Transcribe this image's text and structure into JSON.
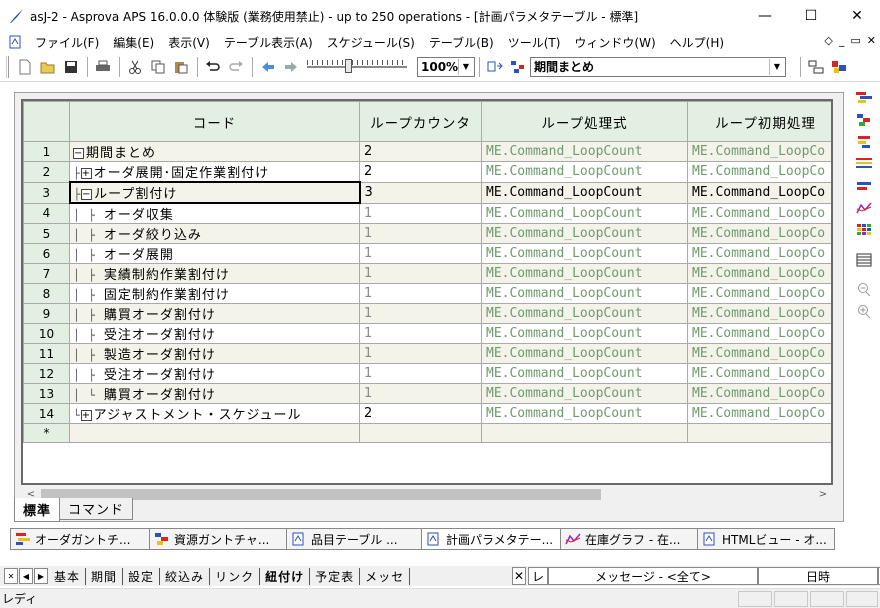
{
  "window": {
    "title": "asJ-2 - Asprova APS 16.0.0.0 体験版 (業務使用禁止)  - up to 250 operations  - [計画パラメタテーブル - 標準]",
    "minimize": "—",
    "maximize": "☐",
    "close": "✕"
  },
  "menu": {
    "items": [
      "ファイル(F)",
      "編集(E)",
      "表示(V)",
      "テーブル表示(A)",
      "スケジュール(S)",
      "テーブル(B)",
      "ツール(T)",
      "ウィンドウ(W)",
      "ヘルプ(H)"
    ],
    "mdi_min": "_",
    "mdi_restore": "▭",
    "mdi_close": "✕"
  },
  "toolbar": {
    "zoom_value": "100%",
    "view_value": "期間まとめ"
  },
  "grid": {
    "headers": [
      "コード",
      "ループカウンタ",
      "ループ処理式",
      "ループ初期処理"
    ],
    "header_visible_partial": "ループ初期処理",
    "rows": [
      {
        "num": "1",
        "lead": "",
        "toggle": "⊟",
        "name": "期間まとめ",
        "count": "2",
        "expr": "ME.Command_LoopCount",
        "init": "ME.Command_LoopCo",
        "count_style": "dark"
      },
      {
        "num": "2",
        "lead": "├",
        "toggle": "⊞",
        "name": "オーダ展開･固定作業割付け",
        "count": "2",
        "expr": "ME.Command_LoopCount",
        "init": "ME.Command_LoopCo",
        "count_style": "dark"
      },
      {
        "num": "3",
        "lead": "├",
        "toggle": "⊟",
        "name": "ループ割付け",
        "count": "3",
        "expr": "ME.Command_LoopCount",
        "init": "ME.Command_LoopCo",
        "count_style": "dark"
      },
      {
        "num": "4",
        "lead": "│ ├",
        "toggle": "",
        "name": "オーダ収集",
        "count": "1",
        "expr": "ME.Command_LoopCount",
        "init": "ME.Command_LoopCo",
        "count_style": "grey"
      },
      {
        "num": "5",
        "lead": "│ ├",
        "toggle": "",
        "name": "オーダ絞り込み",
        "count": "1",
        "expr": "ME.Command_LoopCount",
        "init": "ME.Command_LoopCo",
        "count_style": "grey"
      },
      {
        "num": "6",
        "lead": "│ ├",
        "toggle": "",
        "name": "オーダ展開",
        "count": "1",
        "expr": "ME.Command_LoopCount",
        "init": "ME.Command_LoopCo",
        "count_style": "grey"
      },
      {
        "num": "7",
        "lead": "│ ├",
        "toggle": "",
        "name": "実績制約作業割付け",
        "count": "1",
        "expr": "ME.Command_LoopCount",
        "init": "ME.Command_LoopCo",
        "count_style": "grey"
      },
      {
        "num": "8",
        "lead": "│ ├",
        "toggle": "",
        "name": "固定制約作業割付け",
        "count": "1",
        "expr": "ME.Command_LoopCount",
        "init": "ME.Command_LoopCo",
        "count_style": "grey"
      },
      {
        "num": "9",
        "lead": "│ ├",
        "toggle": "",
        "name": "購買オーダ割付け",
        "count": "1",
        "expr": "ME.Command_LoopCount",
        "init": "ME.Command_LoopCo",
        "count_style": "grey"
      },
      {
        "num": "10",
        "lead": "│ ├",
        "toggle": "",
        "name": "受注オーダ割付け",
        "count": "1",
        "expr": "ME.Command_LoopCount",
        "init": "ME.Command_LoopCo",
        "count_style": "grey"
      },
      {
        "num": "11",
        "lead": "│ ├",
        "toggle": "",
        "name": "製造オーダ割付け",
        "count": "1",
        "expr": "ME.Command_LoopCount",
        "init": "ME.Command_LoopCo",
        "count_style": "grey"
      },
      {
        "num": "12",
        "lead": "│ ├",
        "toggle": "",
        "name": "受注オーダ割付け",
        "count": "1",
        "expr": "ME.Command_LoopCount",
        "init": "ME.Command_LoopCo",
        "count_style": "grey"
      },
      {
        "num": "13",
        "lead": "│ └",
        "toggle": "",
        "name": "購買オーダ割付け",
        "count": "1",
        "expr": "ME.Command_LoopCount",
        "init": "ME.Command_LoopCo",
        "count_style": "grey"
      },
      {
        "num": "14",
        "lead": "└",
        "toggle": "⊞",
        "name": "アジャストメント・スケジュール",
        "count": "2",
        "expr": "ME.Command_LoopCount",
        "init": "ME.Command_LoopCo",
        "count_style": "dark"
      }
    ],
    "new_row_marker": "*",
    "selected_row": 3
  },
  "sheet_tabs": [
    "標準",
    "コマンド"
  ],
  "window_tabs": [
    "オーダガントチ...",
    "資源ガントチャ...",
    "品目テーブル ...",
    "計画パラメタテー...",
    "在庫グラフ - 在...",
    "HTMLビュー - オ..."
  ],
  "bottom_nav": {
    "tabs": [
      "基本",
      "期間",
      "設定",
      "絞込み",
      "リンク",
      "紐付け",
      "予定表",
      "メッセ"
    ],
    "active_tab": "紐付け",
    "msg_level": "レ",
    "message_filter": "メッセージ - <全て>",
    "datetime_label": "日時"
  },
  "status": {
    "text": "レディ"
  },
  "colors": {
    "header_bg": "#e3efe3",
    "expr_green": "#6f9a6f",
    "odd_row_bg": "#f3f3ea"
  }
}
